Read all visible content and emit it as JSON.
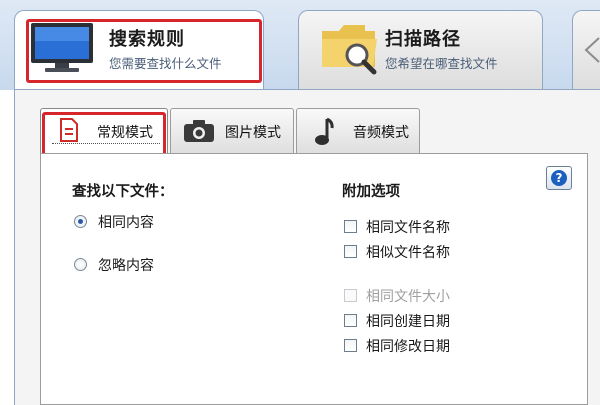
{
  "top_tabs": [
    {
      "title": "搜索规则",
      "subtitle": "您需要查找什么文件"
    },
    {
      "title": "扫描路径",
      "subtitle": "您希望在哪查找文件"
    }
  ],
  "sub_tabs": [
    {
      "label": "常规模式"
    },
    {
      "label": "图片模式"
    },
    {
      "label": "音频模式"
    }
  ],
  "find": {
    "heading": "查找以下文件：",
    "options": [
      {
        "label": "相同内容",
        "checked": true
      },
      {
        "label": "忽略内容",
        "checked": false
      }
    ]
  },
  "extra": {
    "heading": "附加选项",
    "options": [
      {
        "label": "相同文件名称",
        "checked": false,
        "enabled": true
      },
      {
        "label": "相似文件名称",
        "checked": false,
        "enabled": true
      },
      {
        "label": "相同文件大小",
        "checked": false,
        "enabled": false
      },
      {
        "label": "相同创建日期",
        "checked": false,
        "enabled": true
      },
      {
        "label": "相同修改日期",
        "checked": false,
        "enabled": true
      }
    ]
  },
  "help_label": "?",
  "colors": {
    "highlight": "#d6262c",
    "accent": "#1d5fbf"
  }
}
